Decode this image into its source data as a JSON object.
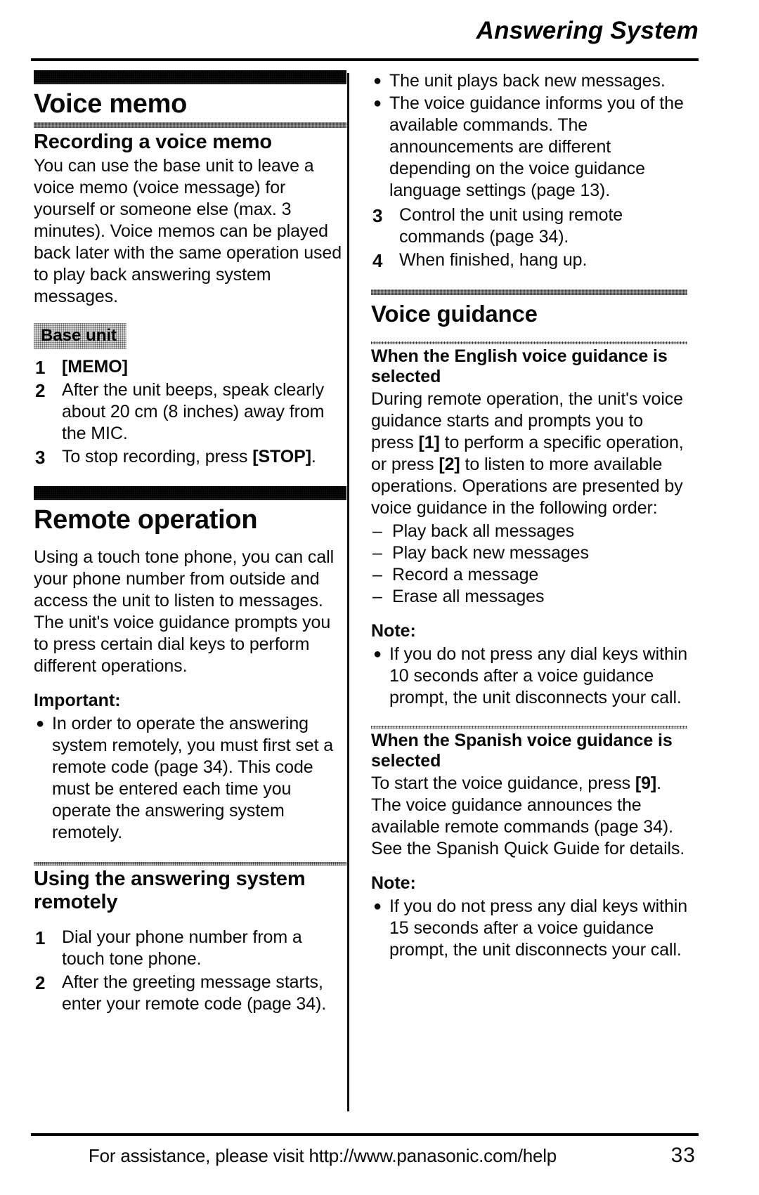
{
  "header": {
    "title": "Answering System"
  },
  "left_column": {
    "section1": {
      "title": "Voice memo",
      "subsection": {
        "title": "Recording a voice memo",
        "intro": "You can use the base unit to leave a voice memo (voice message) for yourself or someone else (max. 3 minutes). Voice memos can be played back later with the same operation used to play back answering system messages.",
        "chip": "Base unit",
        "steps": [
          {
            "num": "1",
            "text": "[MEMO]",
            "bold_key": "[MEMO]"
          },
          {
            "num": "2",
            "text": "After the unit beeps, speak clearly about 20 cm (8 inches) away from the MIC."
          },
          {
            "num": "3",
            "text_before": "To stop recording, press ",
            "bold_key": "[STOP]",
            "text_after": "."
          }
        ]
      }
    },
    "section2": {
      "title": "Remote operation",
      "intro": "Using a touch tone phone, you can call your phone number from outside and access the unit to listen to messages. The unit's voice guidance prompts you to press certain dial keys to perform different operations.",
      "important_label": "Important:",
      "important_bullets": [
        "In order to operate the answering system remotely, you must first set a remote code (page 34). This code must be entered each time you operate the answering system remotely."
      ],
      "subsection": {
        "title": "Using the answering system remotely",
        "steps": [
          {
            "num": "1",
            "text": "Dial your phone number from a touch tone phone."
          },
          {
            "num": "2",
            "text": "After the greeting message starts, enter your remote code (page 34)."
          }
        ]
      }
    }
  },
  "right_column": {
    "continued_bullets": [
      "The unit plays back new messages.",
      "The voice guidance informs you of the available commands. The announcements are different depending on the voice guidance language settings (page 13)."
    ],
    "continued_steps": [
      {
        "num": "3",
        "text": "Control the unit using remote commands (page 34)."
      },
      {
        "num": "4",
        "text": "When finished, hang up."
      }
    ],
    "section3": {
      "title": "Voice guidance",
      "english": {
        "title": "When the English voice guidance is selected",
        "para_part1": "During remote operation, the unit's voice guidance starts and prompts you to press ",
        "key1": "[1]",
        "para_part2": " to perform a specific operation, or press ",
        "key2": "[2]",
        "para_part3": " to listen to more available operations. Operations are presented by voice guidance in the following order:",
        "order_list": [
          "Play back all messages",
          "Play back new messages",
          "Record a message",
          "Erase all messages"
        ],
        "note_label": "Note:",
        "note_bullets": [
          "If you do not press any dial keys within 10 seconds after a voice guidance prompt, the unit disconnects your call."
        ]
      },
      "spanish": {
        "title": "When the Spanish voice guidance is selected",
        "para_part1": "To start the voice guidance, press ",
        "key1": "[9]",
        "para_part2": ". The voice guidance announces the available remote commands (page 34). See the Spanish Quick Guide for details.",
        "note_label": "Note:",
        "note_bullets": [
          "If you do not press any dial keys within 15 seconds after a voice guidance prompt, the unit disconnects your call."
        ]
      }
    }
  },
  "footer": {
    "assistance_text": "For assistance, please visit http://www.panasonic.com/help",
    "page_number": "33"
  },
  "icons": {
    "bullet": "●",
    "dash": "–"
  }
}
